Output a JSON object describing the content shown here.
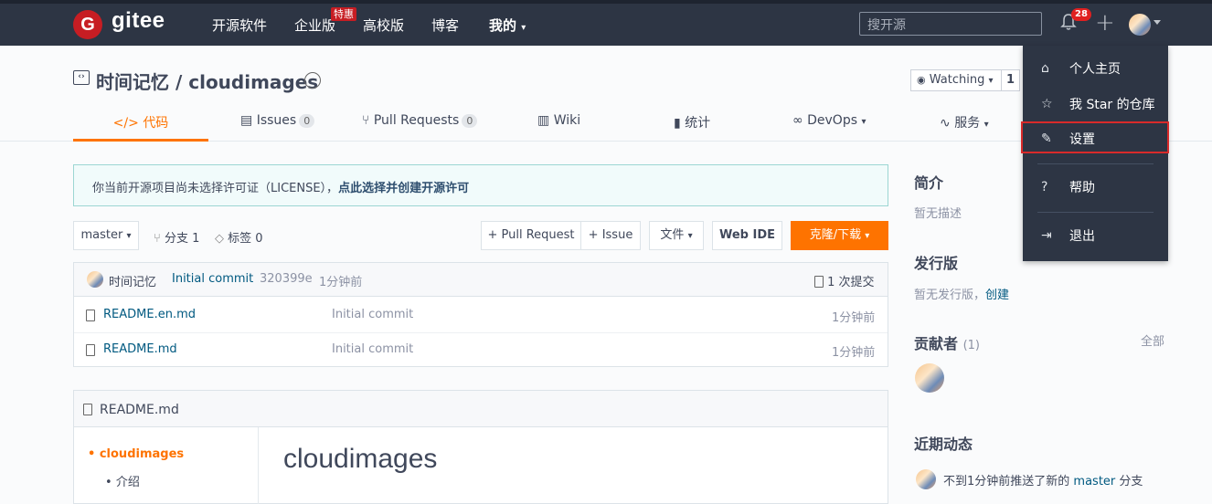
{
  "topnav": {
    "logo_letter": "G",
    "logo_text": "gitee",
    "links": [
      "开源软件",
      "企业版",
      "高校版",
      "博客",
      "我的"
    ],
    "special_badge": "特惠",
    "search_placeholder": "搜开源",
    "notifications": "28"
  },
  "repo": {
    "title": "时间记忆 / cloudimages",
    "watch_label": "Watching",
    "watch_count": "1"
  },
  "tabs": [
    {
      "label": "代码"
    },
    {
      "label": "Issues",
      "count": "0"
    },
    {
      "label": "Pull Requests",
      "count": "0"
    },
    {
      "label": "Wiki"
    },
    {
      "label": "统计"
    },
    {
      "label": "DevOps"
    },
    {
      "label": "服务"
    }
  ],
  "license_notice": {
    "text": "你当前开源项目尚未选择许可证（LICENSE），",
    "link": "点此选择并创建开源许可"
  },
  "toolbar": {
    "branch": "master",
    "branches": "分支 1",
    "tags": "标签 0",
    "pull_request": "+ Pull Request",
    "issue": "+ Issue",
    "file": "文件",
    "webide": "Web IDE",
    "clone": "克隆/下载"
  },
  "commit": {
    "author": "时间记忆",
    "message": "Initial commit",
    "hash": "320399e",
    "time": "1分钟前",
    "count": "1 次提交"
  },
  "files": [
    {
      "name": "README.en.md",
      "message": "Initial commit",
      "time": "1分钟前"
    },
    {
      "name": "README.md",
      "message": "Initial commit",
      "time": "1分钟前"
    }
  ],
  "readme": {
    "filename": "README.md",
    "toc": [
      "cloudimages",
      "介绍"
    ],
    "heading": "cloudimages"
  },
  "sidebar": {
    "intro_title": "简介",
    "intro_text": "暂无描述",
    "release_title": "发行版",
    "release_text": "暂无发行版，",
    "release_link": "创建",
    "contrib_title": "贡献者",
    "contrib_count": "(1)",
    "contrib_all": "全部",
    "activity_title": "近期动态",
    "activity_text": "不到1分钟前推送了新的",
    "activity_branch": "master",
    "activity_suffix": "分支"
  },
  "dropdown": {
    "items": [
      "个人主页",
      "我 Star 的仓库",
      "设置",
      "帮助",
      "退出"
    ]
  }
}
